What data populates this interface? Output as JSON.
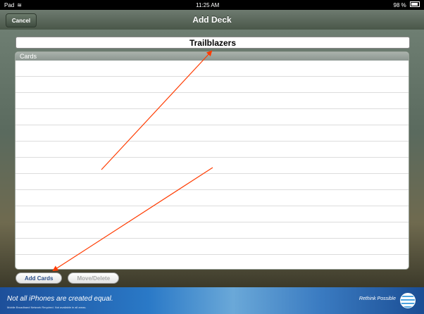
{
  "status_bar": {
    "carrier": "Pad",
    "time": "11:25 AM",
    "battery": "98 %"
  },
  "nav_bar": {
    "cancel_label": "Cancel",
    "title": "Add Deck"
  },
  "deck_name": {
    "value": "Trailblazers"
  },
  "cards_section": {
    "header": "Cards",
    "rows": [
      "",
      "",
      "",
      "",
      "",
      "",
      "",
      "",
      "",
      "",
      "",
      "",
      ""
    ]
  },
  "toolbar": {
    "add_cards_label": "Add Cards",
    "move_delete_label": "Move/Delete"
  },
  "ad_banner": {
    "headline": "Not all iPhones are created equal.",
    "fineprint": "Mobile Broadband Network Required. Not available in all areas.",
    "tagline": "Rethink Possible"
  },
  "colors": {
    "annotation_arrow": "#ff3b00",
    "nav_bar": "#56645a"
  }
}
